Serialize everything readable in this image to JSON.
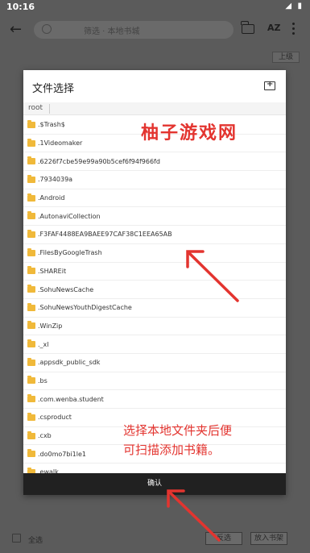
{
  "status_bar": {
    "time": "10:16",
    "icons_text": "◢ ▮"
  },
  "app_bar": {
    "search_text": "筛选 · 本地书城",
    "sort_label": "AZ"
  },
  "up_level_label": "上级",
  "dialog": {
    "title": "文件选择",
    "breadcrumb_root": "root",
    "items": [
      ".$Trash$",
      ".1Videomaker",
      ".6226f7cbe59e99a90b5cef6f94f966fd",
      ".7934039a",
      ".Android",
      ".AutonaviCollection",
      ".F3FAF4488EA9BAEE97CAF38C1EEA65AB",
      ".FilesByGoogleTrash",
      ".SHAREit",
      ".SohuNewsCache",
      ".SohuNewsYouthDigestCache",
      ".WinZip",
      "._xl",
      ".appsdk_public_sdk",
      ".bs",
      ".com.wenba.student",
      ".csproduct",
      ".cxb",
      ".do0mo7bi1le1",
      ".ewalk"
    ],
    "confirm_label": "确认"
  },
  "bottom_bar": {
    "select_all_label": "全选",
    "invert_label": "反选",
    "add_shelf_label": "放入书架"
  },
  "overlay": {
    "watermark": "柚子游戏网",
    "annotation_line1": "选择本地文件夹后便",
    "annotation_line2": "可扫描添加书籍。"
  },
  "colors": {
    "accent_red": "#e3342f",
    "folder_yellow": "#f0b93a",
    "confirm_bg": "#212121"
  }
}
